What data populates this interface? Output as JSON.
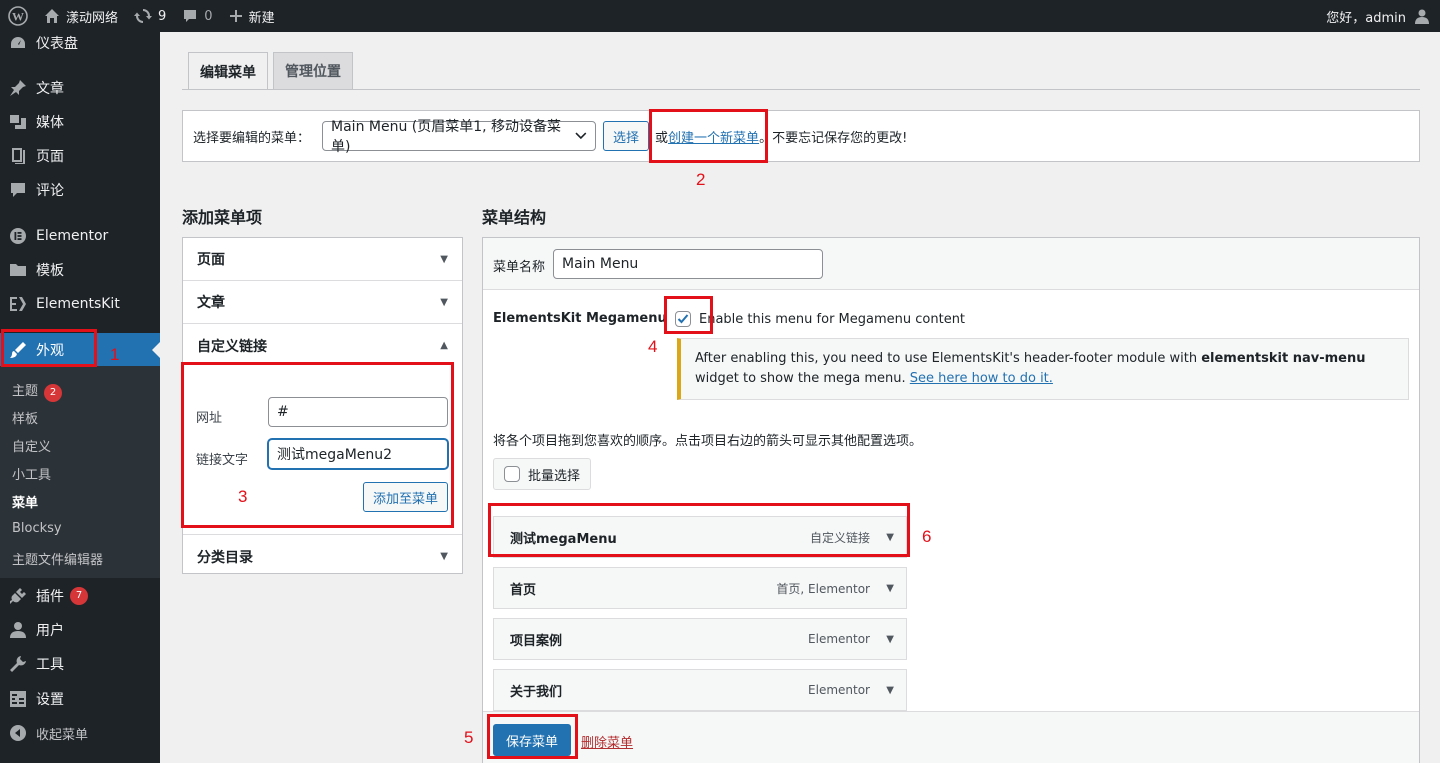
{
  "adminbar": {
    "site_name": "漾动网络",
    "updates_count": "9",
    "comments_count": "0",
    "new_label": "新建",
    "greeting": "您好，admin"
  },
  "sidebar": {
    "items": [
      {
        "label": "仪表盘",
        "icon": "dashboard-icon"
      },
      {
        "label": "文章",
        "icon": "pin-icon"
      },
      {
        "label": "媒体",
        "icon": "media-icon"
      },
      {
        "label": "页面",
        "icon": "page-icon"
      },
      {
        "label": "评论",
        "icon": "comment-icon"
      },
      {
        "label": "Elementor",
        "icon": "elementor-icon"
      },
      {
        "label": "模板",
        "icon": "folder-icon"
      },
      {
        "label": "ElementsKit",
        "icon": "elementskit-icon"
      },
      {
        "label": "外观",
        "icon": "brush-icon"
      },
      {
        "label": "插件",
        "icon": "plugin-icon",
        "badge": "7"
      },
      {
        "label": "用户",
        "icon": "user-icon"
      },
      {
        "label": "工具",
        "icon": "wrench-icon"
      },
      {
        "label": "设置",
        "icon": "settings-icon"
      },
      {
        "label": "收起菜单",
        "icon": "collapse-icon"
      }
    ],
    "submenu": [
      {
        "label": "主题",
        "badge": "2"
      },
      {
        "label": "样板"
      },
      {
        "label": "自定义"
      },
      {
        "label": "小工具"
      },
      {
        "label": "菜单"
      },
      {
        "label": "Blocksy"
      },
      {
        "label": "主题文件编辑器"
      }
    ]
  },
  "tabs": [
    "编辑菜单",
    "管理位置"
  ],
  "manage": {
    "label": "选择要编辑的菜单：",
    "selected_menu": "Main Menu (页眉菜单1, 移动设备菜单)",
    "select_button": "选择",
    "or_text": "或",
    "create_link": "创建一个新菜单",
    "period": "。",
    "reminder": "不要忘记保存您的更改!"
  },
  "add_items": {
    "title": "添加菜单项",
    "sections": [
      "页面",
      "文章",
      "自定义链接",
      "分类目录"
    ],
    "url_label": "网址",
    "url_value": "#",
    "link_text_label": "链接文字",
    "link_text_value": "测试megaMenu2",
    "add_button": "添加至菜单"
  },
  "structure": {
    "title": "菜单结构",
    "name_label": "菜单名称",
    "name_value": "Main Menu",
    "megamenu_label": "ElementsKit Megamenu",
    "megamenu_checkbox_label": "Enable this menu for Megamenu content",
    "megamenu_checked": true,
    "notice_part1": "After enabling this, you need to use ElementsKit's header-footer module with ",
    "notice_bold": "elementskit nav-menu",
    "notice_part2": " widget to show the mega menu. ",
    "notice_link": "See here how to do it.",
    "instructions": "将各个项目拖到您喜欢的顺序。点击项目右边的箭头可显示其他配置选项。",
    "bulk_select": "批量选择",
    "items": [
      {
        "title": "测试megaMenu",
        "type": "自定义链接"
      },
      {
        "title": "首页",
        "type": "首页, Elementor"
      },
      {
        "title": "项目案例",
        "type": "Elementor"
      },
      {
        "title": "关于我们",
        "type": "Elementor"
      }
    ],
    "save_button": "保存菜单",
    "delete_link": "删除菜单"
  },
  "annotations": [
    "1",
    "2",
    "3",
    "4",
    "5",
    "6"
  ],
  "colors": {
    "admin_dark": "#1d2327",
    "accent_blue": "#2271b1",
    "annotation_red": "#e3101a",
    "badge_red": "#d63638",
    "notice_yellow": "#dba617"
  }
}
